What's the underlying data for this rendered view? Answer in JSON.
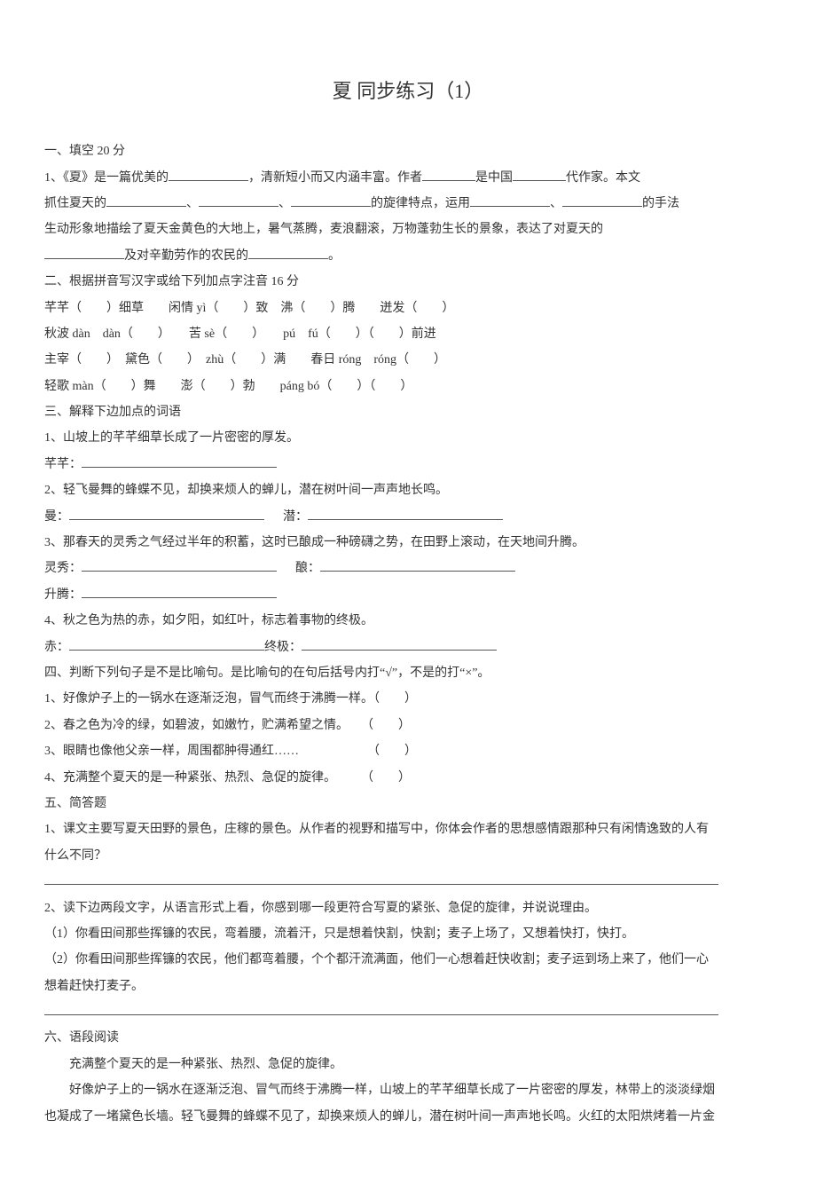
{
  "title": "夏 同步练习（1）",
  "s1": {
    "head": "一、填空 20 分",
    "q1a": "1、《夏》是一篇优美的",
    "q1b": "，清新短小而又内涵丰富。作者",
    "q1c": "是中国",
    "q1d": "代作家。本文",
    "q1e": "抓住夏天的",
    "sep": "、",
    "q1f": "的旋律特点，运用",
    "q1g": "的手法",
    "q1h": "生动形象地描绘了夏天金黄色的大地上，暑气蒸腾，麦浪翻滚，万物蓬勃生长的景象，表达了对夏天的",
    "q1i": "及对辛勤劳作的农民的",
    "period": "。"
  },
  "s2": {
    "head": "二、根据拼音写汉字或给下列加点字注音 16 分",
    "l1a": "芊芊（　　）细草　　闲情 yì（　　）致　沸（　　）腾　　迸发（　　）",
    "l2a": "秋波 dàn　dàn（　　）　　苦 sè（　　）　　pú　fú（　　）（　　）前进",
    "l3a": "主宰（　　）　黛色（　　）　zhù（　　）满　　春日 róng　róng（　　）",
    "l4a": "轻歌 màn（　　）舞　　澎（　　）勃　　páng bó（　　）（　　）"
  },
  "s3": {
    "head": "三、解释下边加点的词语",
    "q1": "1、山坡上的芊芊细草长成了一片密密的厚发。",
    "q1k": "芊芊：",
    "q2": "2、轻飞曼舞的蜂蝶不见，却换来烦人的蝉儿，潜在树叶间一声声地长鸣。",
    "q2k1": "曼：",
    "q2k2": "潜：",
    "q3": "3、那春天的灵秀之气经过半年的积蓄，这时已酿成一种磅礴之势，在田野上滚动，在天地间升腾。",
    "q3k1": "灵秀：",
    "q3k2": "酿：",
    "q3k3": "升腾：",
    "q4": "4、秋之色为热的赤，如夕阳，如红叶，标志着事物的终极。",
    "q4k1": "赤：",
    "q4k2": "终极："
  },
  "s4": {
    "head": "四、判断下列句子是不是比喻句。是比喻句的在句后括号内打“√”，不是的打“×”。",
    "q1": "1、好像炉子上的一锅水在逐渐泛泡，冒气而终于沸腾一样。（　　）",
    "q2": "2、春之色为冷的绿，如碧波，如嫩竹，贮满希望之情。　　（　　）",
    "q3": "3、眼睛也像他父亲一样，周围都肿得通红……　　　　　　（　　）",
    "q4": "4、充满整个夏天的是一种紧张、热烈、急促的旋律。　　　（　　）"
  },
  "s5": {
    "head": "五、简答题",
    "q1a": "1、课文主要写夏天田野的景色，庄稼的景色。从作者的视野和描写中，你体会作者的思想感情跟那种只有闲情逸致的人有",
    "q1b": "什么不同？",
    "q2": "2、读下边两段文字，从语言形式上看，你感到哪一段更符合写夏的紧张、急促的旋律，并说说理由。",
    "q2a": "（1）你看田间那些挥镰的农民，弯着腰，流着汗，只是想着快割，快割；麦子上场了，又想着快打，快打。",
    "q2b": "（2）你看田间那些挥镰的农民，他们都弯着腰，个个都汗流满面，他们一心想着赶快收割；麦子运到场上来了，他们一心",
    "q2c": "想着赶快打麦子。"
  },
  "s6": {
    "head": "六、语段阅读",
    "p1": "充满整个夏天的是一种紧张、热烈、急促的旋律。",
    "p2": "好像炉子上的一锅水在逐渐泛泡、冒气而终于沸腾一样，山坡上的芊芊细草长成了一片密密的厚发，林带上的淡淡绿烟",
    "p3": "也凝成了一堵黛色长墙。轻飞曼舞的蜂蝶不见了，却换来烦人的蝉儿，潜在树叶间一声声地长鸣。火红的太阳烘烤着一片金"
  }
}
